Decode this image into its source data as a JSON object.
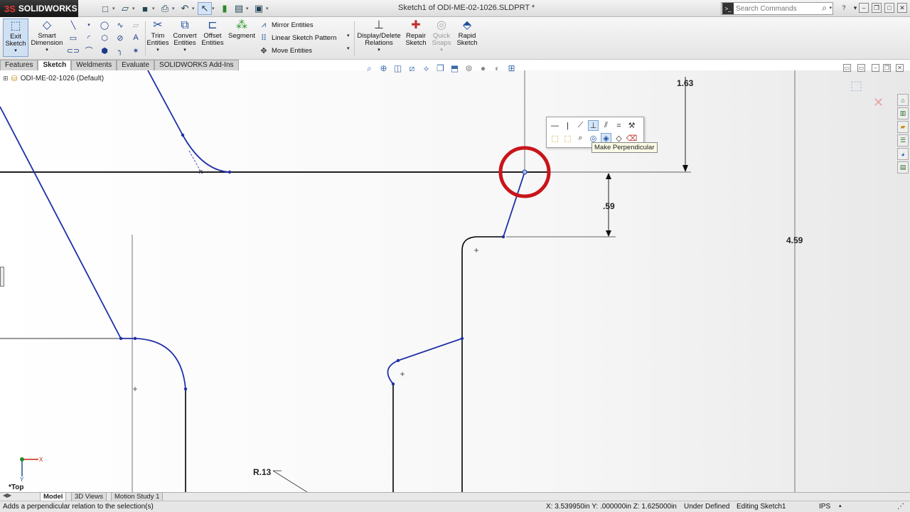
{
  "app": {
    "logo_prefix": "3S",
    "logo_text": "SOLIDWORKS",
    "document_title": "Sketch1 of ODI-ME-02-1026.SLDPRT *",
    "search_placeholder": "Search Commands"
  },
  "toolbar": {
    "exit_sketch": [
      "Exit",
      "Sketch"
    ],
    "smart_dimension": [
      "Smart",
      "Dimension"
    ],
    "trim_entities": [
      "Trim",
      "Entities"
    ],
    "convert_entities": [
      "Convert",
      "Entities"
    ],
    "offset_entities": [
      "Offset",
      "Entities"
    ],
    "segment": "Segment",
    "mirror_entities": "Mirror Entities",
    "linear_sketch_pattern": "Linear Sketch Pattern",
    "move_entities": "Move Entities",
    "display_delete_relations": [
      "Display/Delete",
      "Relations"
    ],
    "repair_sketch": [
      "Repair",
      "Sketch"
    ],
    "quick_snaps": [
      "Quick",
      "Snaps"
    ],
    "rapid_sketch": [
      "Rapid",
      "Sketch"
    ]
  },
  "tabs": [
    "Features",
    "Sketch",
    "Weldments",
    "Evaluate",
    "SOLIDWORKS Add-Ins"
  ],
  "active_tab": "Sketch",
  "tree": {
    "part_name": "ODI-ME-02-1026  (Default)"
  },
  "context_toolbar": {
    "tooltip": "Make Perpendicular",
    "highlighted_icon": "make-perpendicular-icon"
  },
  "dimensions": {
    "d1": "1.63",
    "d2": ".59",
    "d3": "4.59",
    "radius": "R.13"
  },
  "view": {
    "orientation": "*Top",
    "triad_x": "X",
    "triad_y": "Y"
  },
  "bottom_tabs": [
    "Model",
    "3D Views",
    "Motion Study 1"
  ],
  "status": {
    "message": "Adds a perpendicular relation to the selection(s)",
    "coordinates": "X: 3.539950in Y: .000000in Z: 1.625000in",
    "definition": "Under Defined",
    "mode": "Editing Sketch1",
    "units": "IPS"
  },
  "colors": {
    "sketch_underdefined": "#1f2fa8",
    "sketch_defined": "#000000",
    "highlight_circle": "#c8151b",
    "accent": "#1e4f9e"
  }
}
